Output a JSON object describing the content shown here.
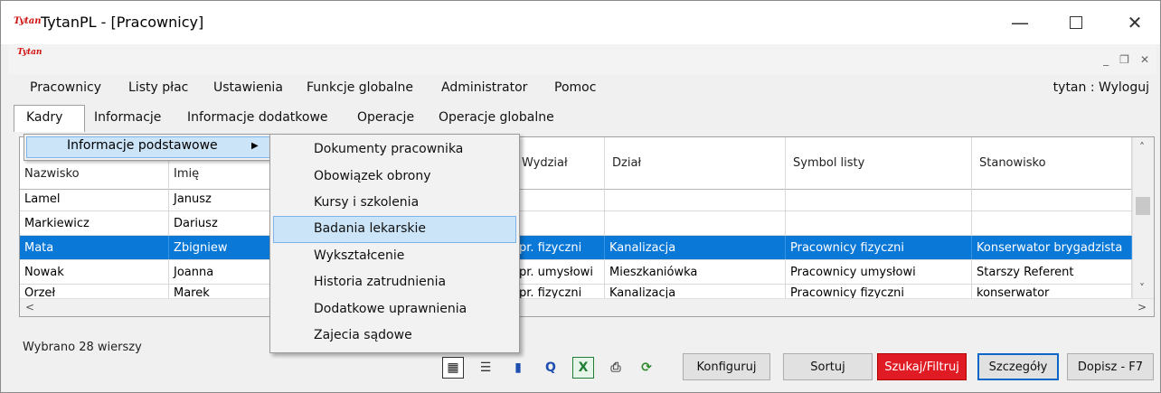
{
  "window": {
    "logo_text": "Tytan",
    "title": "TytanPL - [Pracownicy]",
    "minimize_glyph": "—",
    "close_glyph": "✕"
  },
  "mdi": {
    "logo_text": "Tytan",
    "minimize_glyph": "_",
    "restore_glyph": "❐",
    "close_glyph": "✕"
  },
  "menubar": {
    "items": [
      "Pracownicy",
      "Listy płac",
      "Ustawienia",
      "Funkcje globalne",
      "Administrator",
      "Pomoc"
    ],
    "user": "tytan : Wyloguj"
  },
  "tabs": [
    "Kadry",
    "Informacje",
    "Informacje dodatkowe",
    "Operacje",
    "Operacje globalne"
  ],
  "grid": {
    "columns": [
      "Nazwisko",
      "Imię",
      "",
      "Wydział",
      "Dział",
      "Symbol listy",
      "Stanowisko"
    ],
    "rows": [
      [
        "Lamel",
        "Janusz",
        "",
        "",
        "",
        "",
        ""
      ],
      [
        "Markiewicz",
        "Dariusz",
        "",
        "",
        "",
        "",
        ""
      ],
      [
        "Mata",
        "Zbigniew",
        "",
        "pr. fizyczni",
        "Kanalizacja",
        "Pracownicy fizyczni",
        "Konserwator brygadzista"
      ],
      [
        "Nowak",
        "Joanna",
        "",
        "pr. umysłowi",
        "Mieszkaniówka",
        "Pracownicy umysłowi",
        "Starszy Referent"
      ],
      [
        "Orzeł",
        "Marek",
        "",
        "pr. fizyczni",
        "Kanalizacja",
        "Pracownicy fizyczni",
        "konserwator"
      ]
    ],
    "selected_row": 2,
    "scroll_up": "˄",
    "scroll_down": "˅",
    "scroll_left": "<",
    "scroll_right": ">"
  },
  "submenu1": {
    "label": "Informacje podstawowe",
    "arrow": "▶"
  },
  "submenu2": {
    "items": [
      "Dokumenty pracownika",
      "Obowiązek obrony",
      "Kursy i szkolenia",
      "Badania lekarskie",
      "Wykształcenie",
      "Historia zatrudnienia",
      "Dodatkowe uprawnienia",
      "Zajecia sądowe"
    ],
    "highlighted": 3
  },
  "footer": {
    "status": "Wybrano 28 wierszy",
    "icons": {
      "table_view": "▦",
      "list_view": "☰",
      "chart": "▮",
      "query": "Q",
      "excel": "X",
      "print": "⎙",
      "refresh": "⟳"
    },
    "buttons": {
      "configure": "Konfiguruj",
      "sort": "Sortuj",
      "search": "Szukaj/Filtruj",
      "details": "Szczegóły",
      "add": "Dopisz - F7"
    }
  },
  "colors": {
    "selection": "#0a78d7",
    "menu_highlight": "#cce4f7",
    "search_button": "#e01b24",
    "logo": "#d01010",
    "excel_icon": "#1e7e34"
  }
}
